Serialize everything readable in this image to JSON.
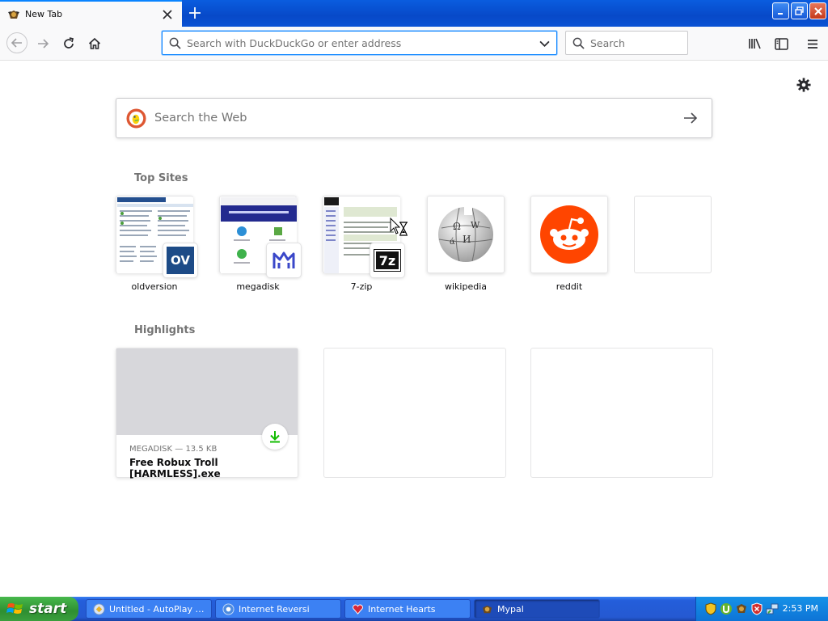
{
  "browser": {
    "tab": {
      "title": "New Tab"
    },
    "urlbar": {
      "placeholder": "Search with DuckDuckGo or enter address",
      "value": ""
    },
    "searchbar": {
      "placeholder": "Search"
    }
  },
  "newtab": {
    "web_search": {
      "placeholder": "Search the Web"
    },
    "top_sites_title": "Top Sites",
    "top_sites": [
      {
        "label": "oldversion",
        "badge": "OV"
      },
      {
        "label": "megadisk"
      },
      {
        "label": "7-zip",
        "badge": "7z"
      },
      {
        "label": "wikipedia"
      },
      {
        "label": "reddit"
      },
      {
        "label": ""
      }
    ],
    "highlights_title": "Highlights",
    "highlights": [
      {
        "meta": "MEGADISK — 13.5 KB",
        "title": "Free Robux Troll [HARMLESS].exe"
      }
    ]
  },
  "taskbar": {
    "start_label": "start",
    "tasks": [
      {
        "label": "Untitled - AutoPlay M..."
      },
      {
        "label": "Internet Reversi"
      },
      {
        "label": "Internet Hearts"
      },
      {
        "label": "Mypal"
      }
    ],
    "clock": "2:53 PM"
  },
  "colors": {
    "accent": "#0a84ff",
    "reddit": "#ff4500",
    "download": "#12bc00",
    "ddg": "#de5833"
  }
}
